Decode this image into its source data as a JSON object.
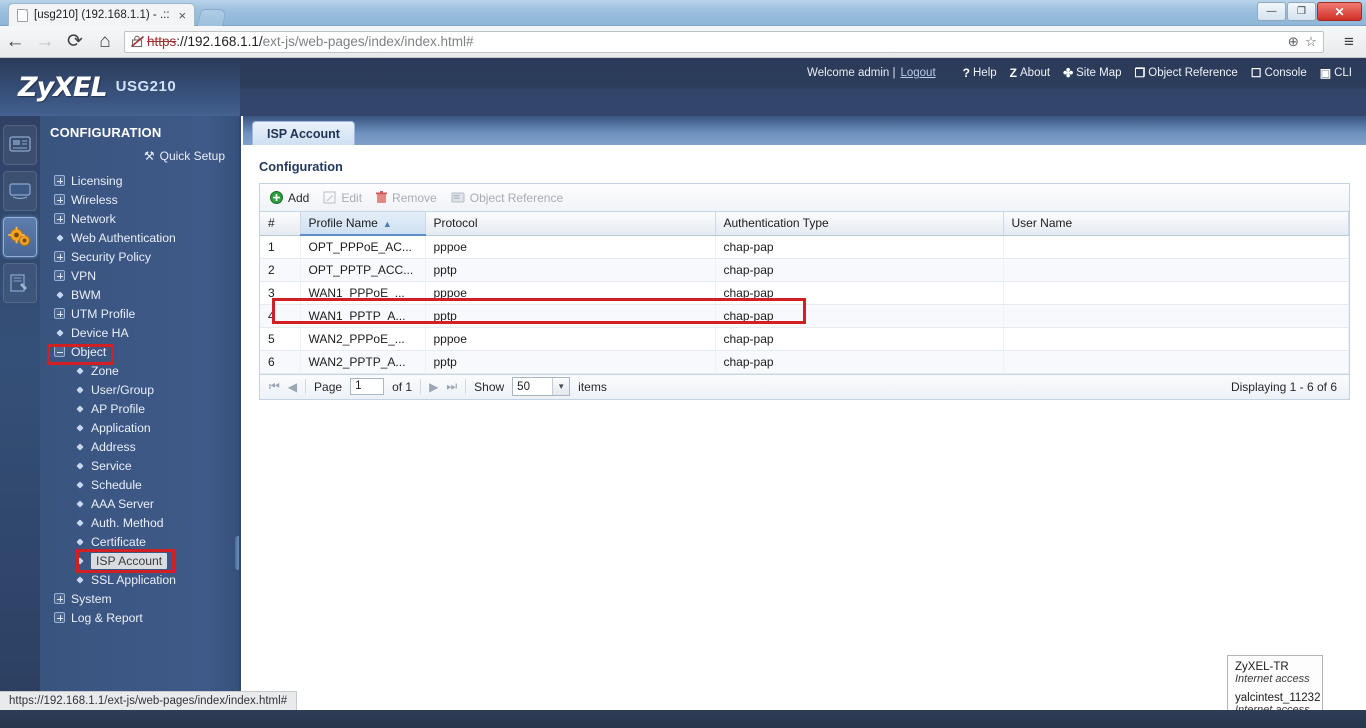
{
  "browser": {
    "tab_title": "[usg210] (192.168.1.1) - .::",
    "tab_close": "×",
    "back_icon": "←",
    "forward_icon": "→",
    "reload_icon": "⟳",
    "home_icon": "⌂",
    "url_scheme_struck": "https",
    "url_rest_prefix": "://192.168.1.1/",
    "url_path": "ext-js/web-pages/index/index.html#",
    "zoom_icon": "⊕",
    "bookmark_icon": "☆",
    "menu_icon": "≡",
    "minimize_label": "—",
    "restore_label": "❐",
    "close_label": "✕"
  },
  "header": {
    "brand": "ZyXEL",
    "model": "USG210",
    "welcome": "Welcome admin |",
    "logout": "Logout",
    "links": [
      {
        "icon": "?",
        "label": "Help"
      },
      {
        "icon": "Z",
        "label": "About"
      },
      {
        "icon": "✤",
        "label": "Site Map"
      },
      {
        "icon": "❐",
        "label": "Object Reference"
      },
      {
        "icon": "☐",
        "label": "Console"
      },
      {
        "icon": "▣",
        "label": "CLI"
      }
    ]
  },
  "rail": {
    "items": [
      {
        "name": "dashboard-icon",
        "active": false
      },
      {
        "name": "monitor-icon",
        "active": false
      },
      {
        "name": "configuration-gears-icon",
        "active": true
      },
      {
        "name": "maintenance-icon",
        "active": false
      }
    ]
  },
  "sidebar": {
    "title": "CONFIGURATION",
    "quick_setup": "Quick Setup",
    "quick_setup_icon": "⚒",
    "items": [
      {
        "label": "Licensing",
        "type": "plus",
        "level": 0
      },
      {
        "label": "Wireless",
        "type": "plus",
        "level": 0
      },
      {
        "label": "Network",
        "type": "plus",
        "level": 0
      },
      {
        "label": "Web Authentication",
        "type": "dot",
        "level": 0
      },
      {
        "label": "Security Policy",
        "type": "plus",
        "level": 0
      },
      {
        "label": "VPN",
        "type": "plus",
        "level": 0
      },
      {
        "label": "BWM",
        "type": "dot",
        "level": 0
      },
      {
        "label": "UTM Profile",
        "type": "plus",
        "level": 0
      },
      {
        "label": "Device HA",
        "type": "dot",
        "level": 0
      },
      {
        "label": "Object",
        "type": "minus",
        "level": 0
      },
      {
        "label": "Zone",
        "type": "dot",
        "level": 1
      },
      {
        "label": "User/Group",
        "type": "dot",
        "level": 1
      },
      {
        "label": "AP Profile",
        "type": "dot",
        "level": 1
      },
      {
        "label": "Application",
        "type": "dot",
        "level": 1
      },
      {
        "label": "Address",
        "type": "dot",
        "level": 1
      },
      {
        "label": "Service",
        "type": "dot",
        "level": 1
      },
      {
        "label": "Schedule",
        "type": "dot",
        "level": 1
      },
      {
        "label": "AAA Server",
        "type": "dot",
        "level": 1
      },
      {
        "label": "Auth. Method",
        "type": "dot",
        "level": 1
      },
      {
        "label": "Certificate",
        "type": "dot",
        "level": 1
      },
      {
        "label": "ISP Account",
        "type": "dot",
        "level": 1,
        "selected": true
      },
      {
        "label": "SSL Application",
        "type": "dot",
        "level": 1
      },
      {
        "label": "System",
        "type": "plus",
        "level": 0
      },
      {
        "label": "Log & Report",
        "type": "plus",
        "level": 0
      }
    ]
  },
  "main": {
    "tab_label": "ISP Account",
    "panel_title": "Configuration",
    "toolbar": [
      {
        "label": "Add",
        "icon": "⊕",
        "enabled": true
      },
      {
        "label": "Edit",
        "icon": "✎",
        "enabled": false
      },
      {
        "label": "Remove",
        "icon": "Ὕ1",
        "enabled": false
      },
      {
        "label": "Object Reference",
        "icon": "❐",
        "enabled": false
      }
    ],
    "columns": [
      "#",
      "Profile Name",
      "Protocol",
      "Authentication Type",
      "User Name"
    ],
    "sorted_column": "Profile Name",
    "sort_arrow": "▲",
    "rows": [
      {
        "n": "1",
        "profile": "OPT_PPPoE_AC...",
        "protocol": "pppoe",
        "auth": "chap-pap",
        "user": ""
      },
      {
        "n": "2",
        "profile": "OPT_PPTP_ACC...",
        "protocol": "pptp",
        "auth": "chap-pap",
        "user": ""
      },
      {
        "n": "3",
        "profile": "WAN1_PPPoE_...",
        "protocol": "pppoe",
        "auth": "chap-pap",
        "user": ""
      },
      {
        "n": "4",
        "profile": "WAN1_PPTP_A...",
        "protocol": "pptp",
        "auth": "chap-pap",
        "user": ""
      },
      {
        "n": "5",
        "profile": "WAN2_PPPoE_...",
        "protocol": "pppoe",
        "auth": "chap-pap",
        "user": ""
      },
      {
        "n": "6",
        "profile": "WAN2_PPTP_A...",
        "protocol": "pptp",
        "auth": "chap-pap",
        "user": ""
      }
    ],
    "pager": {
      "first_icon": "⏮",
      "prev_icon": "◀",
      "page_label": "Page",
      "page_value": "1",
      "of_label": "of 1",
      "next_icon": "▶",
      "last_icon": "⏭",
      "show_label": "Show",
      "show_value": "50",
      "items_label": "items",
      "select_arrow": "▼",
      "displaying": "Displaying 1 - 6 of 6"
    }
  },
  "wifi_popup": {
    "networks": [
      {
        "name": "ZyXEL-TR",
        "status": "Internet access",
        "suffix": ""
      },
      {
        "name": "yalcintest_1123",
        "status": "Internet access",
        "suffix": "2"
      }
    ]
  },
  "statusbar": {
    "url": "https://192.168.1.1/ext-js/web-pages/index/index.html#"
  },
  "colors": {
    "annotation_red": "#d21f24",
    "header_navy": "#2b3a59",
    "sidebar_blue": "#3f5a88",
    "accent_blue": "#5b8fc9"
  }
}
